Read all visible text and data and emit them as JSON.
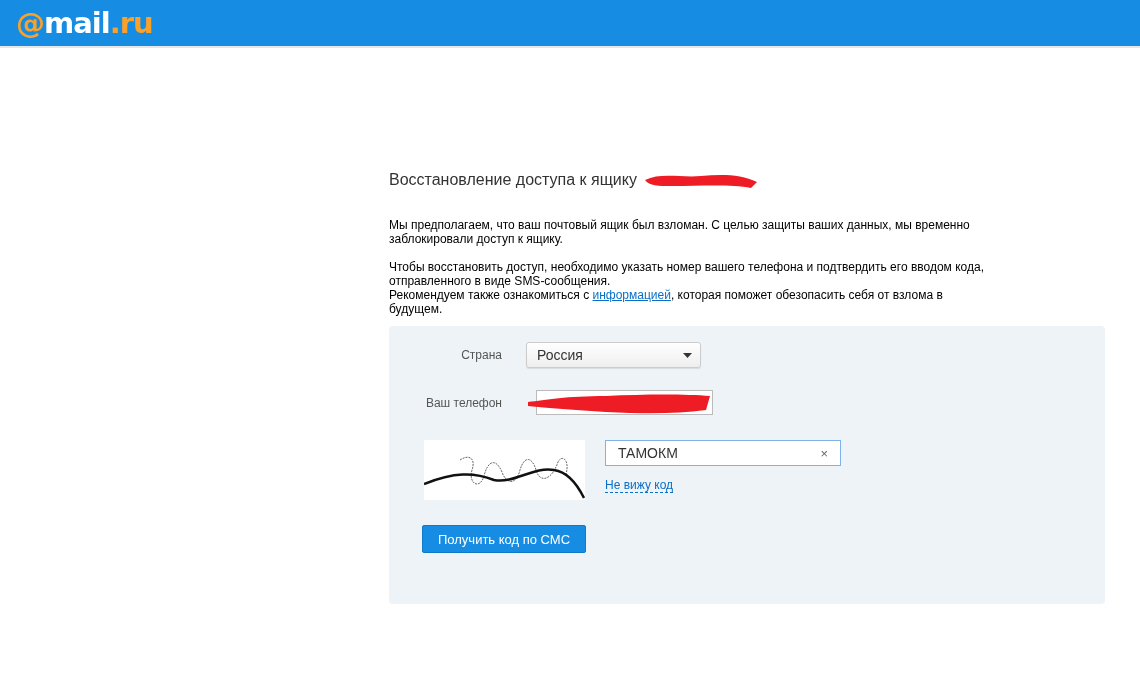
{
  "header": {
    "logo": {
      "at": "@",
      "name": "mail",
      "domain": ".ru"
    }
  },
  "title": "Восстановление доступа к ящику",
  "paragraphs": [
    {
      "text": "Мы предполагаем, что ваш почтовый ящик был взломан. С целью защиты ваших данных, мы временно заблокировали доступ к ящику."
    },
    {
      "text": "Чтобы восстановить доступ, необходимо указать номер вашего телефона и подтвердить его вводом кода, отправленного в виде SMS-сообщения."
    }
  ],
  "recommend": {
    "before": "Рекомендуем также ознакомиться с ",
    "link": "информацией",
    "after": ", которая поможет обезопасить себя от взлома в будущем."
  },
  "form": {
    "country": {
      "label": "Страна",
      "value": "Россия"
    },
    "phone": {
      "label": "Ваш телефон"
    },
    "captcha": {
      "value": "ТАМОКМ",
      "clear": "×",
      "help_link": "Не вижу код"
    },
    "submit": "Получить код по СМС"
  }
}
